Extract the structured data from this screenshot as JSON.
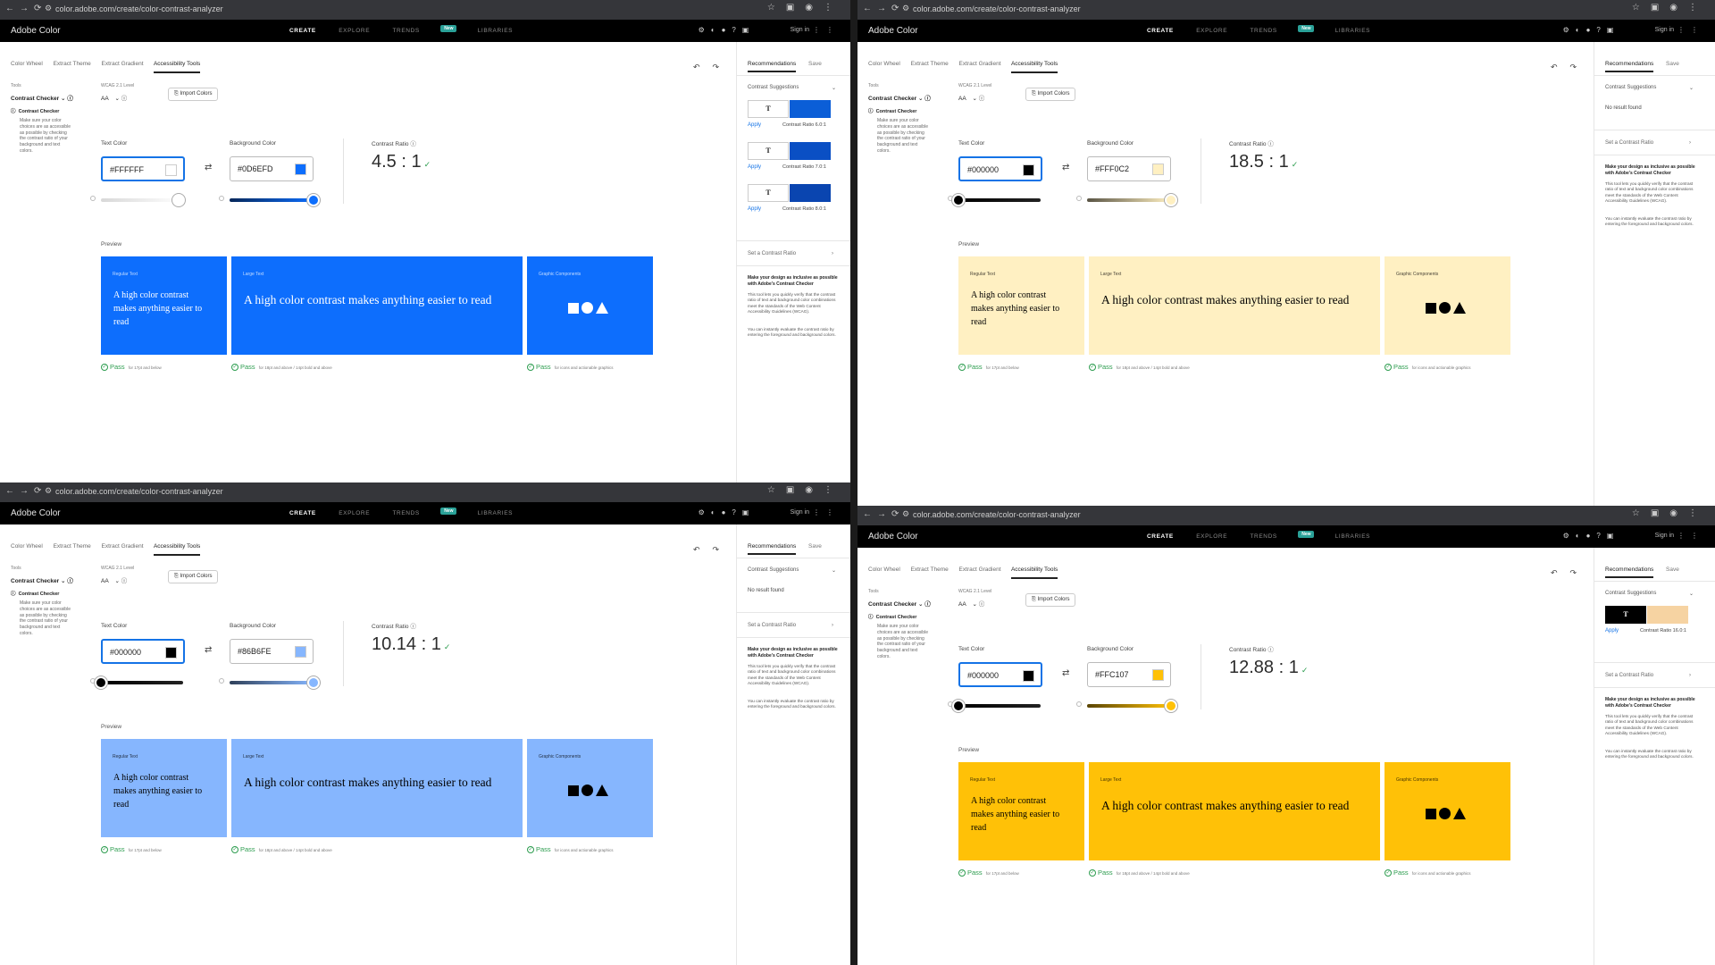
{
  "browser": {
    "url": "color.adobe.com/create/color-contrast-analyzer"
  },
  "app": {
    "brand": "Adobe Color",
    "nav": [
      "CREATE",
      "EXPLORE",
      "TRENDS",
      "LAB",
      "LIBRARIES"
    ],
    "new_badge": "New",
    "sign_in": "Sign in"
  },
  "tabs": [
    "Color Wheel",
    "Extract Theme",
    "Extract Gradient",
    "Accessibility Tools"
  ],
  "tools_label": "Tools",
  "tool_value": "Contrast Checker",
  "wcag_label": "WCAG 2.1 Level",
  "wcag_value": "AA",
  "import_label": "Import Colors",
  "cc_heading": "Contrast Checker",
  "cc_description": "Make sure your color choices are as accessible as possible by checking the contrast ratio of your background and text colors.",
  "text_color_label": "Text Color",
  "bg_color_label": "Background Color",
  "contrast_label": "Contrast Ratio",
  "preview_label": "Preview",
  "regular_text_label": "Regular Text",
  "large_text_label": "Large Text",
  "graphic_label": "Graphic Components",
  "sample_text": "A high color contrast makes anything easier to read",
  "pass_label": "Pass",
  "pass_regular_note": "for 17pt and below",
  "pass_large_note": "for 18pt and above / 14pt bold and above",
  "pass_graphic_note": "for icons and actionable graphics",
  "rp": {
    "tab_recommendations": "Recommendations",
    "tab_save": "Save",
    "suggestions_label": "Contrast Suggestions",
    "no_result": "No result found",
    "apply_label": "Apply",
    "set_ratio_label": "Set a Contrast Ratio",
    "info_heading": "Make your design as inclusive as possible with Adobe's Contrast Checker",
    "info_p1": "This tool lets you quickly verify that the contrast ratio of text and background color combinations meet the standards of the Web Content Accessibility Guidelines (WCAG).",
    "info_p2": "You can instantly evaluate the contrast ratio by entering the foreground and background colors."
  },
  "panes": [
    {
      "text_hex": "#FFFFFF",
      "bg_hex": "#0D6EFD",
      "ratio": "4.5 : 1",
      "text_color": "#ffffff",
      "bg_color": "#0d6efd",
      "text_slider_level": 0.95,
      "bg_slider_level": 1.0,
      "suggestions": [
        {
          "text_color": "#ffffff",
          "bg_color": "#0b5ed7",
          "ratio_text": "Contrast Ratio 6.0:1"
        },
        {
          "text_color": "#ffffff",
          "bg_color": "#0a4fc4",
          "ratio_text": "Contrast Ratio 7.0:1"
        },
        {
          "text_color": "#ffffff",
          "bg_color": "#0a45b0",
          "ratio_text": "Contrast Ratio 8.0:1"
        }
      ]
    },
    {
      "text_hex": "#000000",
      "bg_hex": "#FFF0C2",
      "ratio": "18.5 : 1",
      "text_color": "#000000",
      "bg_color": "#fff0c2",
      "text_slider_level": 0.0,
      "bg_slider_level": 1.0,
      "suggestions": []
    },
    {
      "text_hex": "#000000",
      "bg_hex": "#86B6FE",
      "ratio": "10.14 : 1",
      "text_color": "#000000",
      "bg_color": "#86b6fe",
      "text_slider_level": 0.0,
      "bg_slider_level": 1.0,
      "suggestions": []
    },
    {
      "text_hex": "#000000",
      "bg_hex": "#FFC107",
      "ratio": "12.88 : 1",
      "text_color": "#000000",
      "bg_color": "#ffc107",
      "text_slider_level": 0.0,
      "bg_slider_level": 1.0,
      "suggestions": [
        {
          "text_color": "#ffffff",
          "bg_color": "#000000",
          "alt_bg": "#f6d3a2",
          "ratio_text": "Contrast Ratio 16.0:1"
        }
      ]
    }
  ]
}
